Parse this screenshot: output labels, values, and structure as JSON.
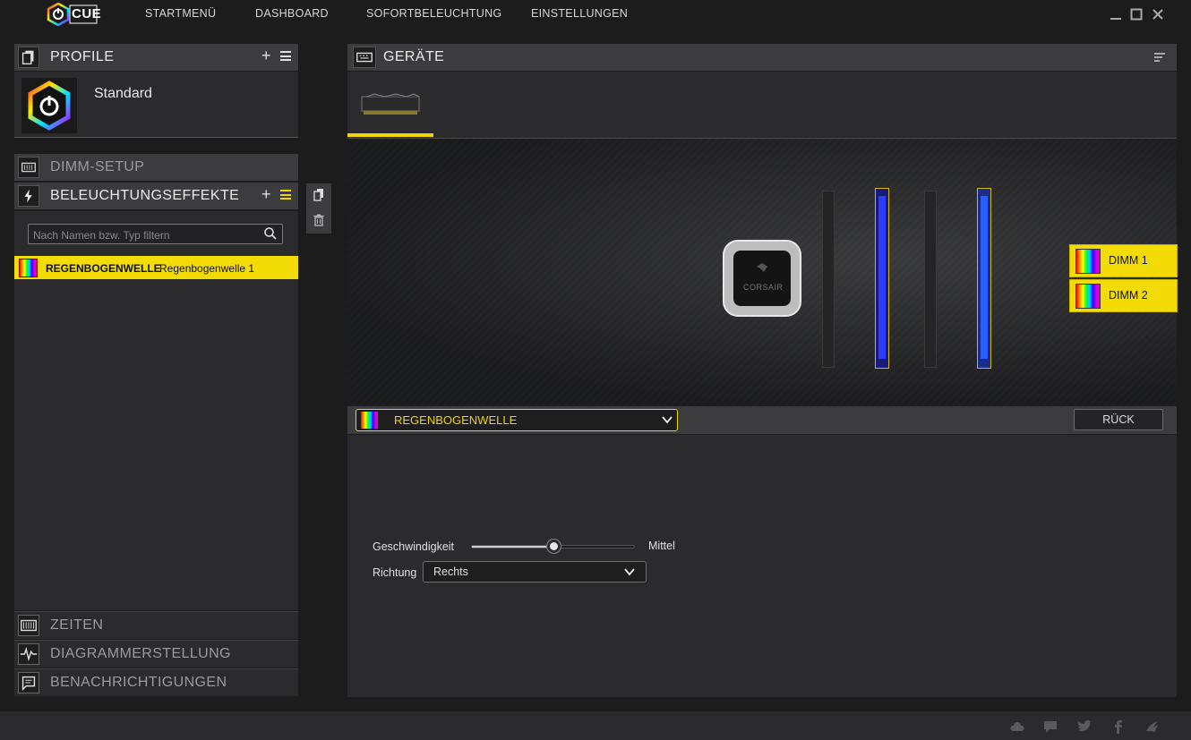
{
  "app": {
    "logo_text": "CUE"
  },
  "nav": {
    "items": [
      "STARTMENÜ",
      "DASHBOARD",
      "SOFORTBELEUCHTUNG",
      "EINSTELLUNGEN"
    ]
  },
  "profiles": {
    "title": "PROFILE",
    "current": "Standard"
  },
  "dimm_setup": {
    "title": "DIMM-SETUP"
  },
  "effects": {
    "title": "BELEUCHTUNGSEFFEKTE",
    "filter_placeholder": "Nach Namen bzw. Typ filtern",
    "list": [
      {
        "type": "REGENBOGENWELLE",
        "name": "Regenbogenwelle 1"
      }
    ]
  },
  "bottom_sections": [
    "ZEITEN",
    "DIAGRAMMERSTELLUNG",
    "BENACHRICHTIGUNGEN"
  ],
  "devices": {
    "title": "GERÄTE",
    "dimms": [
      "DIMM 1",
      "DIMM 2"
    ],
    "cooler_brand": "CORSAIR"
  },
  "effect_editor": {
    "selected_effect": "REGENBOGENWELLE",
    "back_label": "RÜCK",
    "speed_label": "Geschwindigkeit",
    "speed_value": "Mittel",
    "speed_level": 0.5,
    "direction_label": "Richtung",
    "direction_value": "Rechts"
  },
  "colors": {
    "accent": "#f2d600",
    "panel": "#2b2b2d",
    "header": "#3c3c3e",
    "led": "#2b3cff"
  },
  "footer_icons": [
    "cloud-icon",
    "chat-icon",
    "twitter-icon",
    "facebook-icon",
    "corsair-icon"
  ]
}
